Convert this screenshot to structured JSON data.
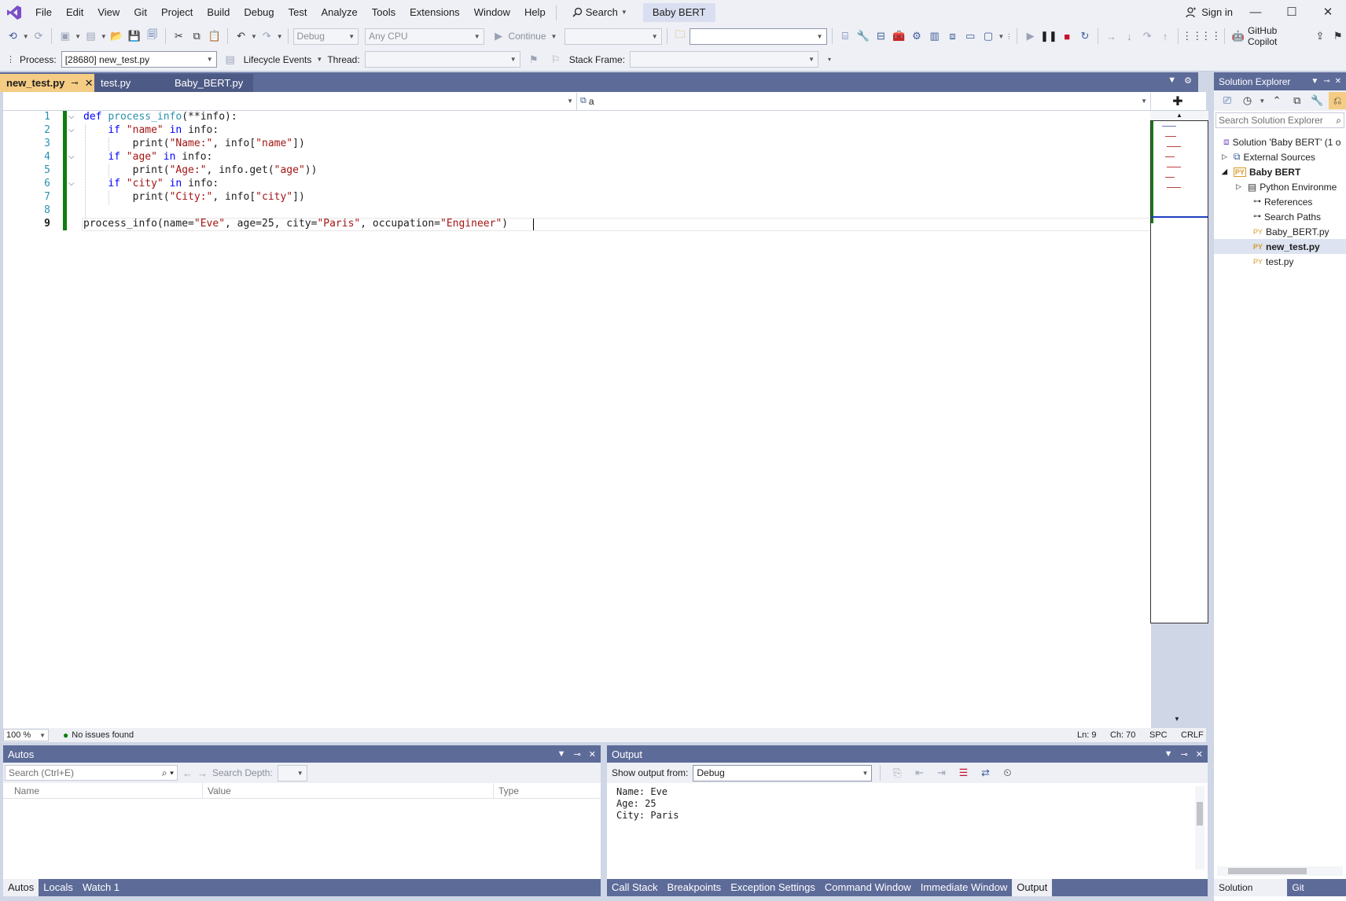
{
  "menu": {
    "items": [
      "File",
      "Edit",
      "View",
      "Git",
      "Project",
      "Build",
      "Debug",
      "Test",
      "Analyze",
      "Tools",
      "Extensions",
      "Window",
      "Help"
    ],
    "search_label": "Search",
    "solution_badge": "Baby BERT",
    "sign_in": "Sign in"
  },
  "toolbar": {
    "config": "Debug",
    "platform": "Any CPU",
    "continue_label": "Continue",
    "copilot_label": "GitHub Copilot"
  },
  "debugbar": {
    "process_label": "Process:",
    "process_value": "[28680] new_test.py",
    "lifecycle_label": "Lifecycle Events",
    "thread_label": "Thread:",
    "stack_frame_label": "Stack Frame:"
  },
  "tabs": [
    {
      "label": "new_test.py",
      "active": true
    },
    {
      "label": "test.py",
      "active": false
    },
    {
      "label": "Baby_BERT.py",
      "active": false
    }
  ],
  "navbar": {
    "member_value": "a"
  },
  "editor": {
    "lines": [
      {
        "num": "1",
        "text": "def process_info(**info):"
      },
      {
        "num": "2",
        "text": "    if \"name\" in info:"
      },
      {
        "num": "3",
        "text": "        print(\"Name:\", info[\"name\"])"
      },
      {
        "num": "4",
        "text": "    if \"age\" in info:"
      },
      {
        "num": "5",
        "text": "        print(\"Age:\", info.get(\"age\"))"
      },
      {
        "num": "6",
        "text": "    if \"city\" in info:"
      },
      {
        "num": "7",
        "text": "        print(\"City:\", info[\"city\"])"
      },
      {
        "num": "8",
        "text": ""
      },
      {
        "num": "9",
        "text": "process_info(name=\"Eve\", age=25, city=\"Paris\", occupation=\"Engineer\")"
      }
    ]
  },
  "editor_status": {
    "zoom": "100 %",
    "issues": "No issues found",
    "line": "Ln: 9",
    "col": "Ch: 70",
    "whitespace": "SPC",
    "line_ending": "CRLF"
  },
  "autos": {
    "title": "Autos",
    "search_placeholder": "Search (Ctrl+E)",
    "search_depth_label": "Search Depth:",
    "columns": [
      "Name",
      "Value",
      "Type"
    ],
    "tabs": [
      "Autos",
      "Locals",
      "Watch 1"
    ]
  },
  "output": {
    "title": "Output",
    "show_from_label": "Show output from:",
    "source": "Debug",
    "lines": [
      "Name: Eve",
      "Age: 25",
      "City: Paris"
    ],
    "tabs": [
      "Call Stack",
      "Breakpoints",
      "Exception Settings",
      "Command Window",
      "Immediate Window",
      "Output"
    ]
  },
  "solution_explorer": {
    "title": "Solution Explorer",
    "search_placeholder": "Search Solution Explorer",
    "solution": "Solution 'Baby BERT' (1 o",
    "items": [
      {
        "label": "External Sources",
        "icon": "external-sources-icon"
      },
      {
        "label": "Baby BERT",
        "icon": "python-project-icon"
      },
      {
        "label": "Python Environme",
        "icon": "python-env-icon"
      },
      {
        "label": "References",
        "icon": "references-icon"
      },
      {
        "label": "Search Paths",
        "icon": "search-paths-icon"
      },
      {
        "label": "Baby_BERT.py",
        "icon": "python-file-icon"
      },
      {
        "label": "new_test.py",
        "icon": "python-file-icon"
      },
      {
        "label": "test.py",
        "icon": "python-file-icon"
      }
    ],
    "py_badge": "PY",
    "tabs": [
      "Solution Explo...",
      "Git Changes"
    ]
  },
  "colors": {
    "accent": "#5d6b99",
    "active_tab": "#f5cc84",
    "keyword": "#0000ff",
    "string": "#a31515",
    "change_bar": "#107c10"
  }
}
